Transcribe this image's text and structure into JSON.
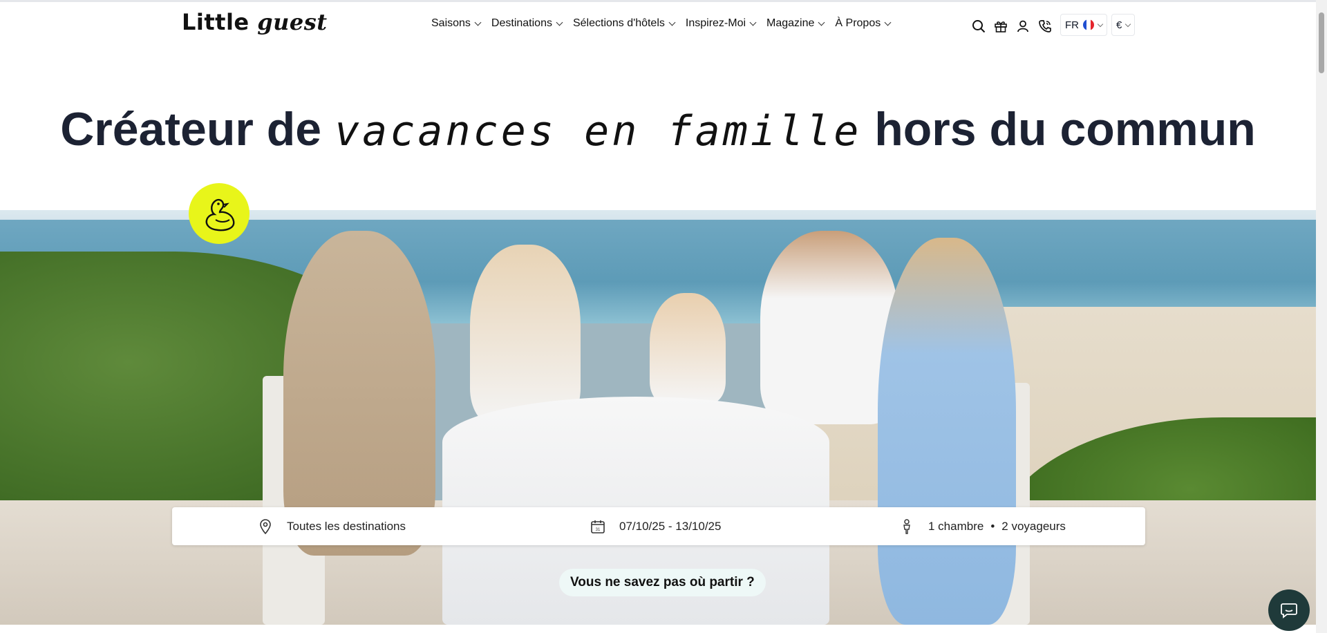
{
  "brand": {
    "logo_text_1": "Little",
    "logo_text_2": "guest"
  },
  "nav": {
    "items": [
      {
        "label": "Saisons"
      },
      {
        "label": "Destinations"
      },
      {
        "label": "Sélections d'hôtels"
      },
      {
        "label": "Inspirez-Moi"
      },
      {
        "label": "Magazine"
      },
      {
        "label": "À Propos"
      }
    ]
  },
  "header_tools": {
    "icons": [
      "search-icon",
      "gift-icon",
      "user-icon",
      "phone-icon"
    ],
    "language": "FR",
    "currency": "€"
  },
  "hero": {
    "title_part_1": "Créateur de ",
    "title_script": "vacances en famille",
    "title_part_2": " hors du commun"
  },
  "search": {
    "destination": "Toutes les destinations",
    "dates": "07/10/25 - 13/10/25",
    "rooms": "1 chambre",
    "separator": "•",
    "travelers": "2 voyageurs"
  },
  "cta": {
    "label": "Vous ne savez pas où partir ?"
  },
  "colors": {
    "accent_yellow": "#e8f51a",
    "chat_bg": "#1f3a3a",
    "title": "#1c2233"
  }
}
